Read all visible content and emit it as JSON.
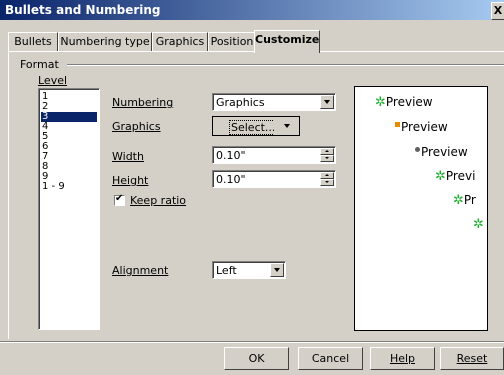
{
  "window": {
    "title": "Bullets and Numbering",
    "close_label": "X"
  },
  "tabs": [
    {
      "label": "Bullets"
    },
    {
      "label": "Numbering type"
    },
    {
      "label": "Graphics"
    },
    {
      "label": "Position"
    },
    {
      "label": "Customize",
      "active": true
    }
  ],
  "format": {
    "group_label": "Format",
    "level_label": "Level",
    "levels": [
      "1",
      "2",
      "3",
      "4",
      "5",
      "6",
      "7",
      "8",
      "9",
      "1 - 9"
    ],
    "selected_level": "3"
  },
  "fields": {
    "numbering_label": "Numbering",
    "numbering_value": "Graphics",
    "graphics_label": "Graphics",
    "graphics_button": "Select...",
    "width_label": "Width",
    "width_value": "0.10\"",
    "height_label": "Height",
    "height_value": "0.10\"",
    "keep_ratio_label": "Keep ratio",
    "keep_ratio_checked": true,
    "alignment_label": "Alignment",
    "alignment_value": "Left"
  },
  "preview": {
    "items": [
      {
        "text": "Preview",
        "bullet": "star-icon"
      },
      {
        "text": "Preview",
        "bullet": "orange-square-icon"
      },
      {
        "text": "Preview",
        "bullet": "gray-ball-icon"
      },
      {
        "text": "Previ",
        "bullet": "star-icon"
      },
      {
        "text": "Pr",
        "bullet": "star-icon"
      },
      {
        "text": "",
        "bullet": "star-icon"
      }
    ]
  },
  "buttons": {
    "ok": "OK",
    "cancel": "Cancel",
    "help": "Help",
    "reset": "Reset"
  }
}
